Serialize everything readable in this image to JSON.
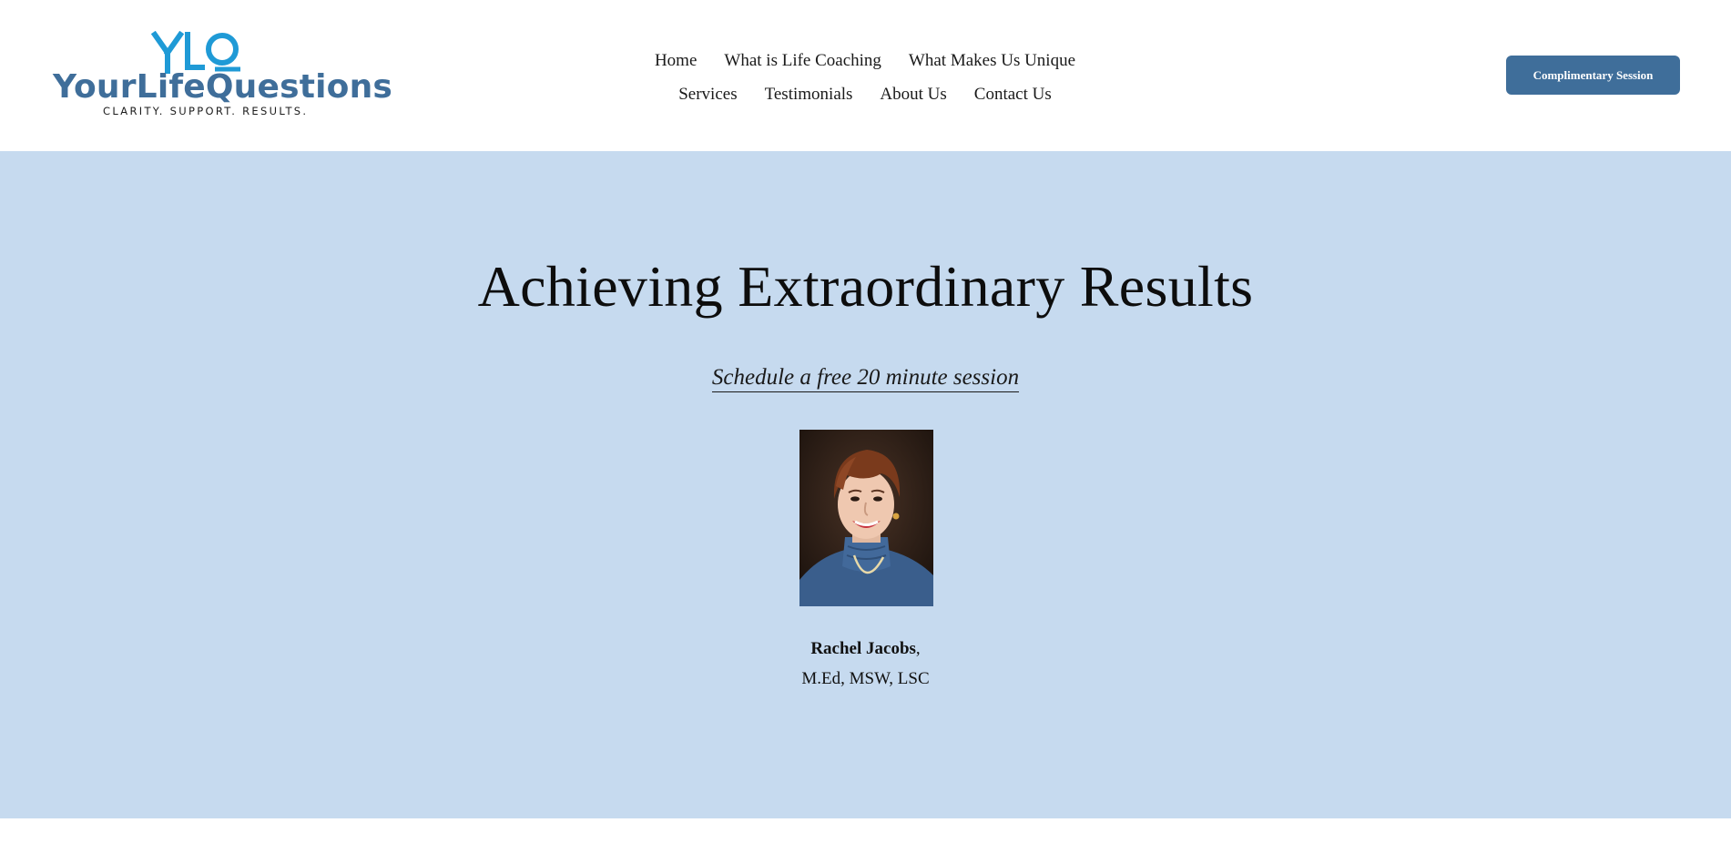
{
  "header": {
    "logo": {
      "mark": "YLQ",
      "wordmark": "YourLifeQuestions",
      "tagline": "CLARITY. SUPPORT. RESULTS."
    },
    "nav": {
      "row1": [
        "Home",
        "What is Life Coaching",
        "What Makes Us Unique"
      ],
      "row2": [
        "Services",
        "Testimonials",
        "About Us",
        "Contact Us"
      ]
    },
    "cta_label": "Complimentary Session"
  },
  "hero": {
    "title": "Achieving Extraordinary Results",
    "schedule_link": "Schedule a free 20 minute session",
    "person": {
      "name": "Rachel Jacobs",
      "name_suffix": ",",
      "credentials": "M.Ed, MSW, LSC"
    },
    "background_color": "#c6daef"
  },
  "colors": {
    "brand_blue": "#3f6e9a",
    "logo_light_blue": "#1f9ad6"
  }
}
